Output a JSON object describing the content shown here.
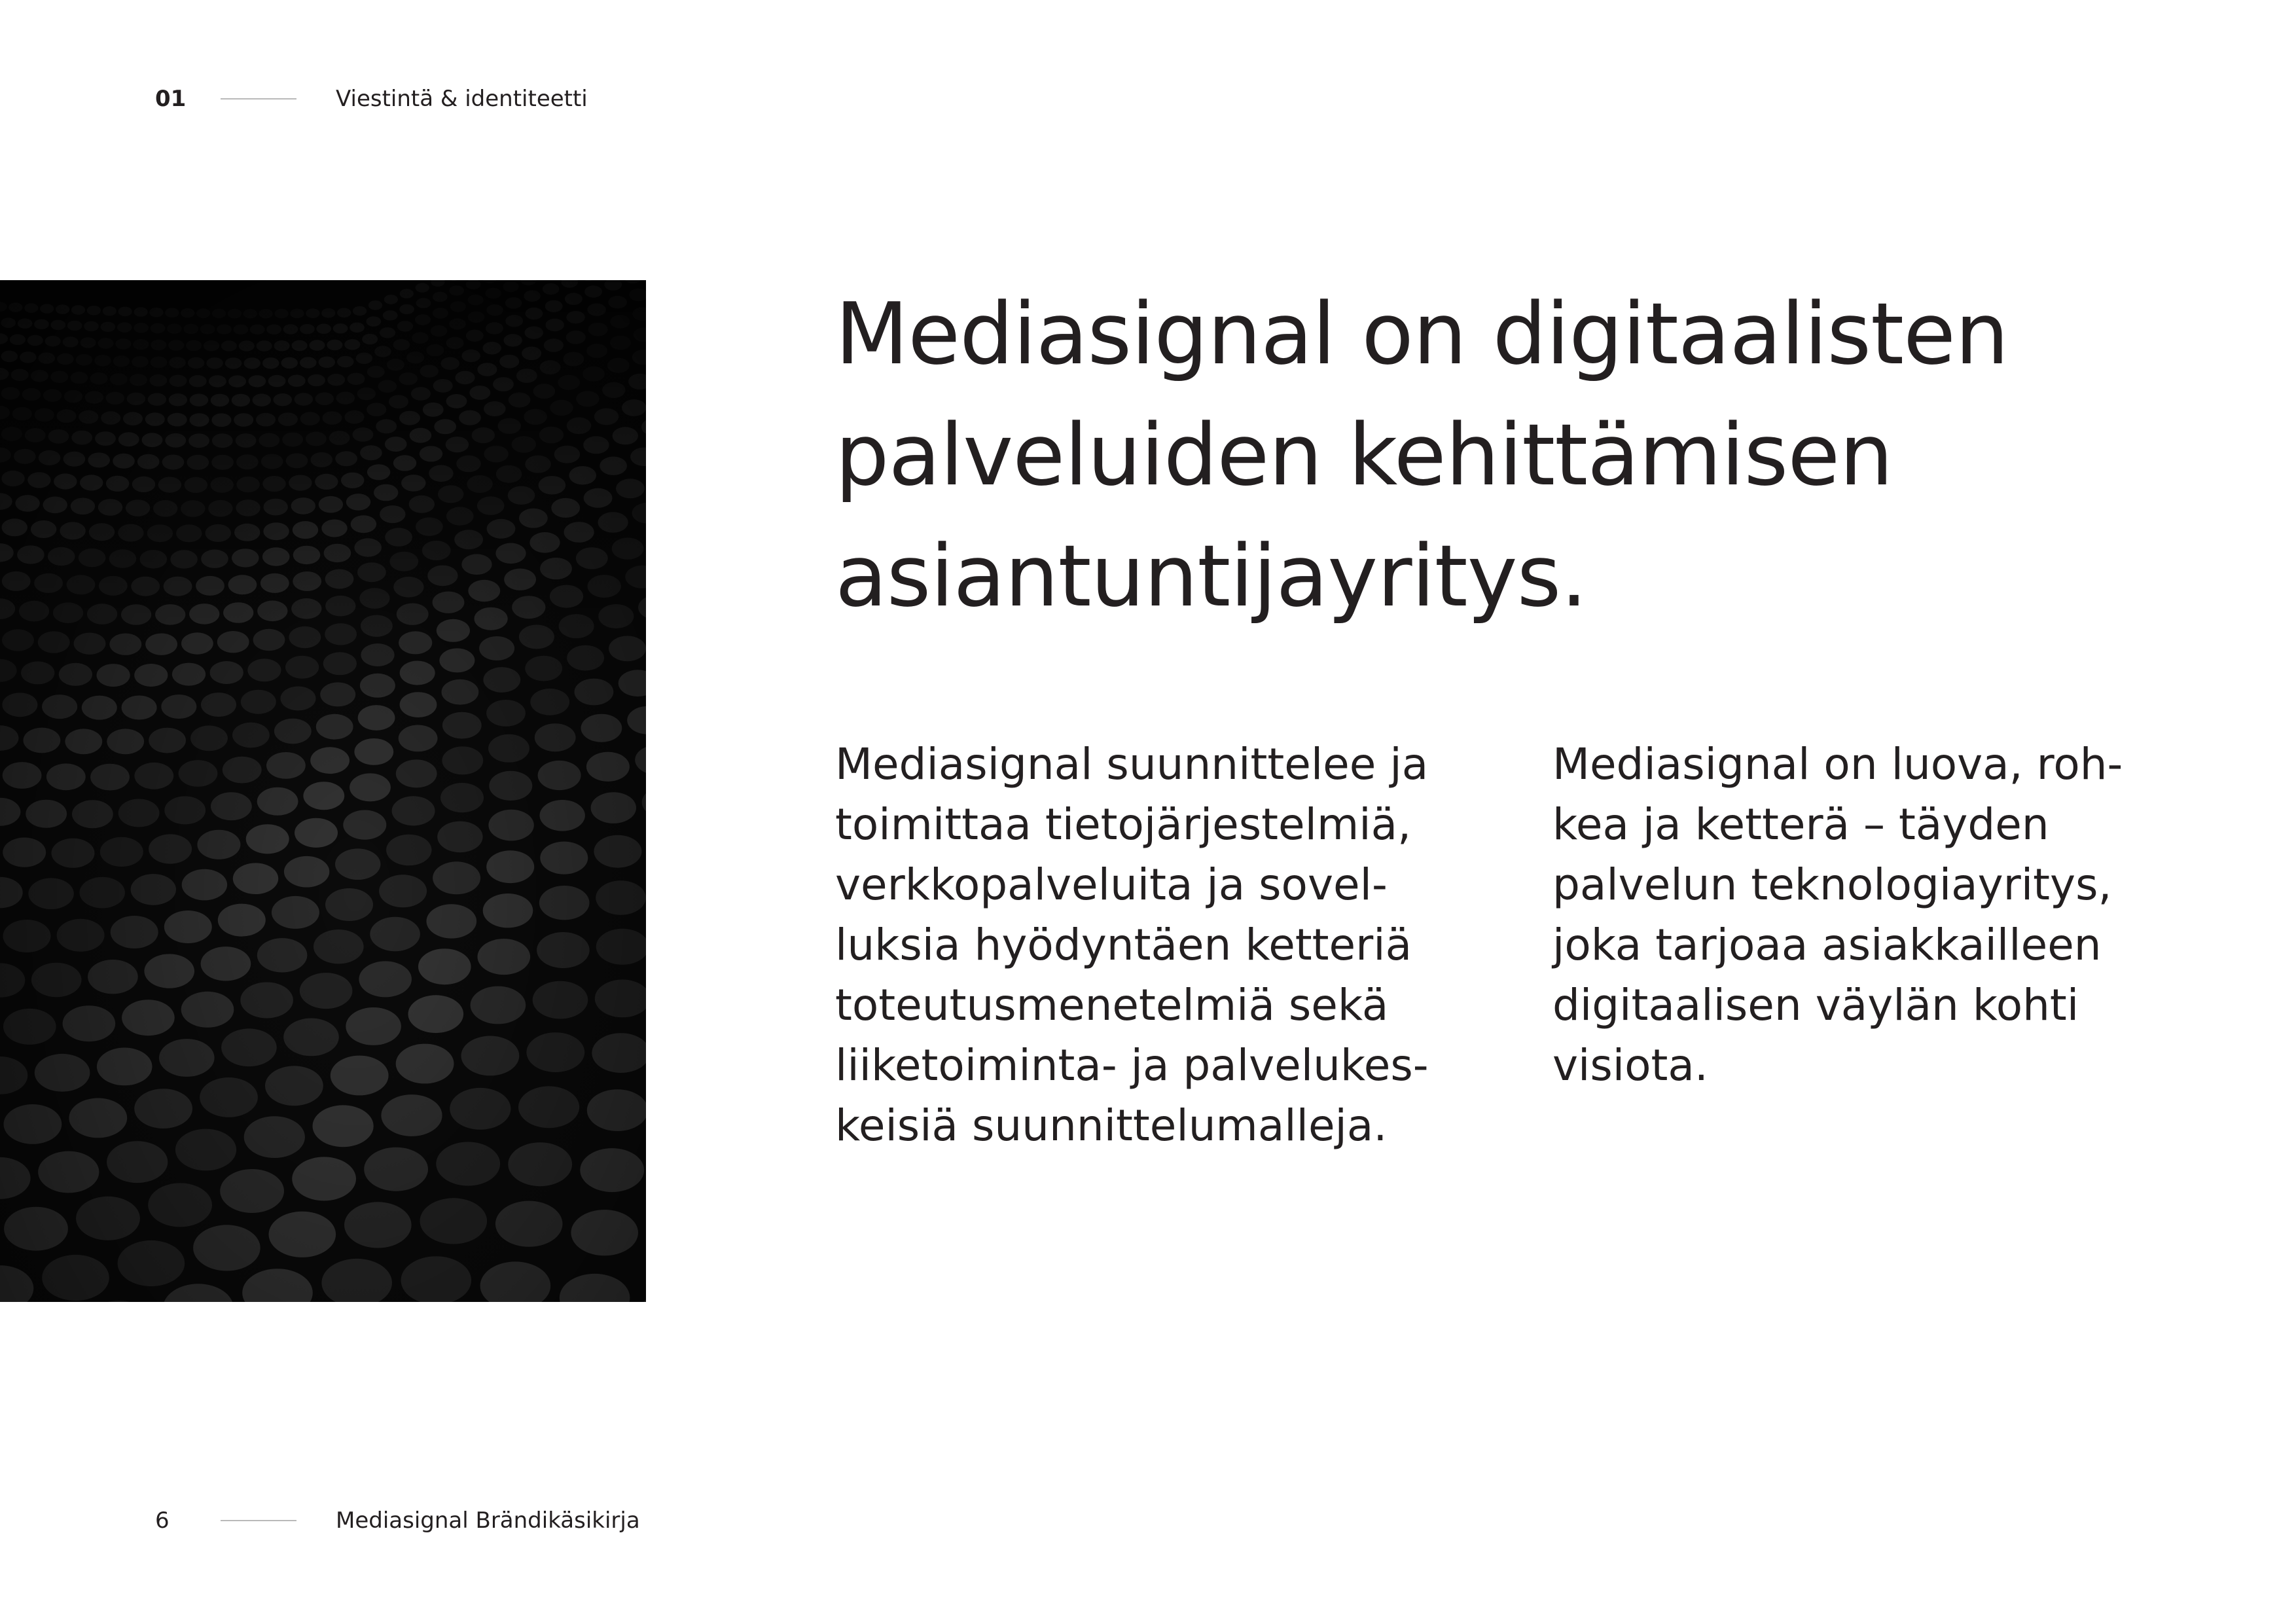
{
  "header": {
    "section_number": "01",
    "section_title": "Viestintä & identiteetti"
  },
  "headline": "Mediasignal on digitaalisten palveluiden kehittämisen asiantuntijayritys.",
  "body": {
    "left": "Mediasignal suunnittelee ja\ntoimittaa tietojärjestelmiä,\nverkkopalveluita ja sovel-\nluksia hyödyntäen ketteriä\ntoteutusmenetelmiä sekä\nliiketoiminta- ja palvelukes-\nkeisiä suunnittelumalleja.",
    "right": "Mediasignal on luova, roh-\nkea ja ketterä – täyden\npalvelun teknologiayritys,\njoka tarjoaa asiakkailleen\ndigitaalisen väylän kohti\nvisiota."
  },
  "footer": {
    "page_number": "6",
    "document_title": "Mediasignal Brändikäsikirja"
  },
  "colors": {
    "text": "#231f20",
    "rule": "#b9b9b9",
    "photo_background": "#0b0b0b",
    "photo_dots": "#3a3a3a"
  }
}
